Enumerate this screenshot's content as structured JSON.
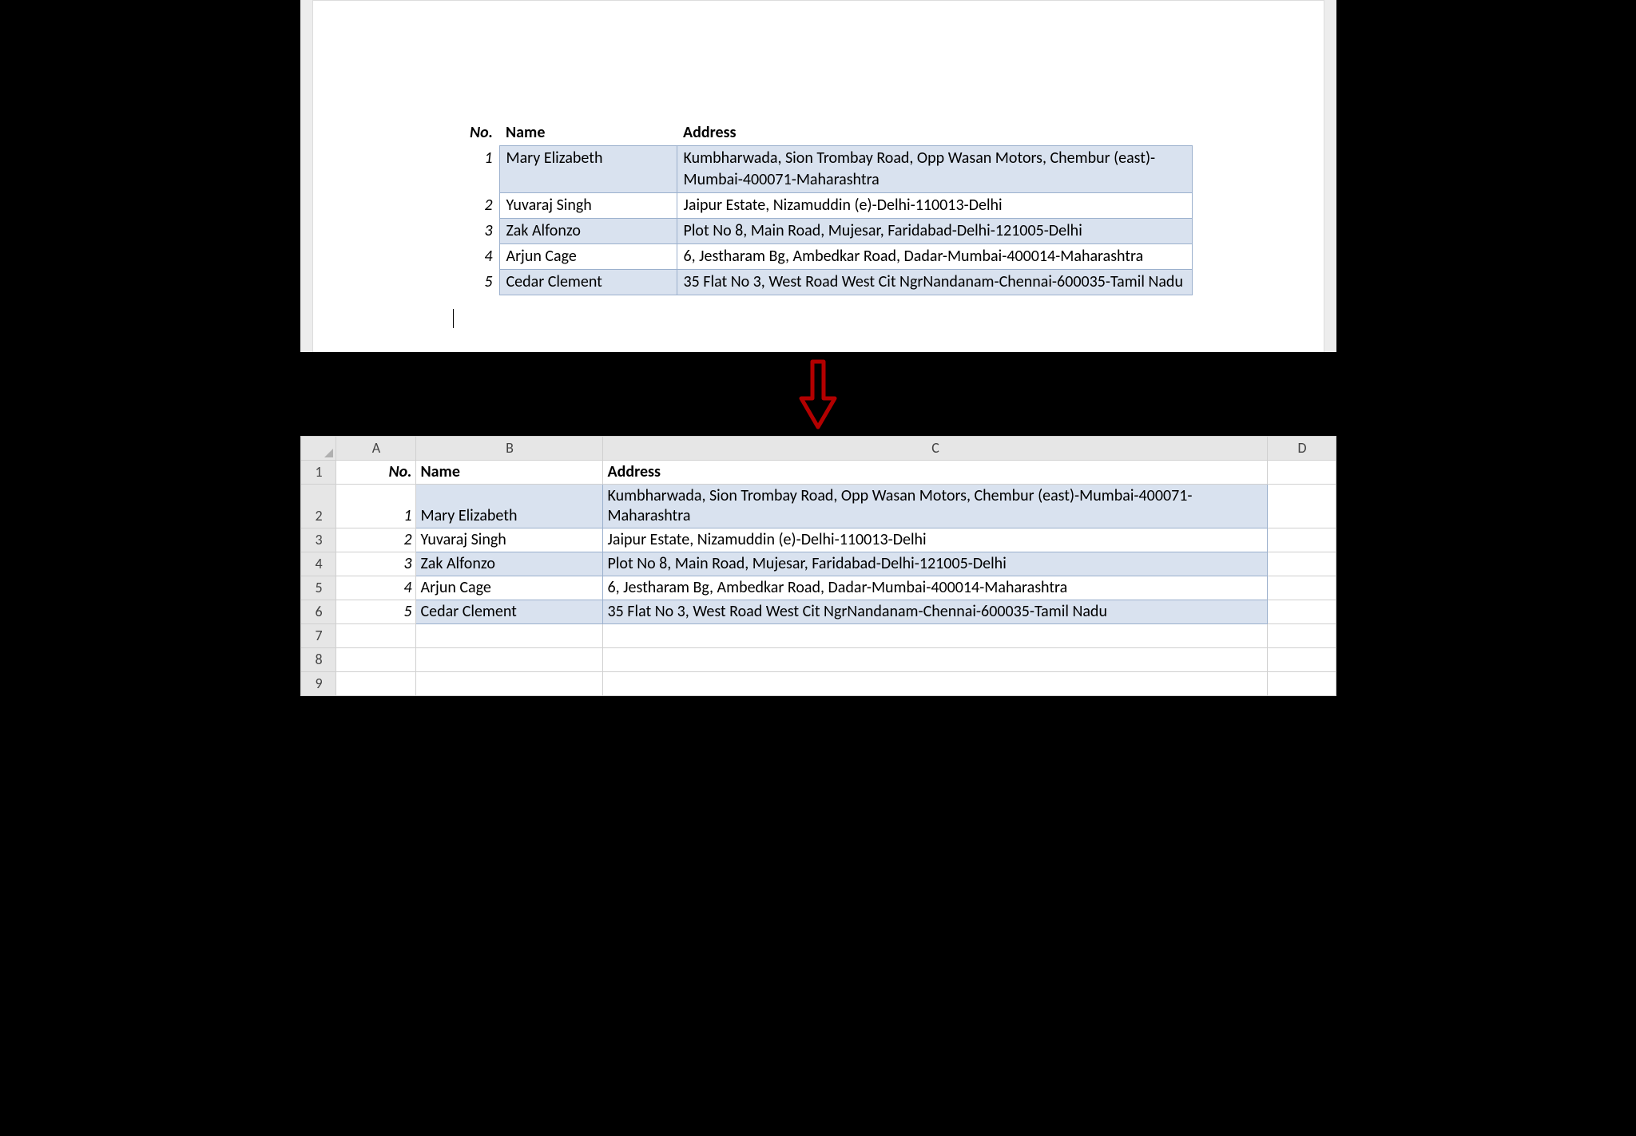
{
  "headers": {
    "no": "No.",
    "name": "Name",
    "addr": "Address"
  },
  "rows": [
    {
      "no": "1",
      "name": "Mary Elizabeth",
      "addr": "Kumbharwada, Sion Trombay Road, Opp Wasan Motors, Chembur (east)-Mumbai-400071-Maharashtra"
    },
    {
      "no": "2",
      "name": "Yuvaraj Singh",
      "addr": "Jaipur Estate, Nizamuddin (e)-Delhi-110013-Delhi"
    },
    {
      "no": "3",
      "name": "Zak Alfonzo",
      "addr": "Plot No 8, Main Road, Mujesar, Faridabad-Delhi-121005-Delhi"
    },
    {
      "no": "4",
      "name": "Arjun Cage",
      "addr": "6, Jestharam Bg, Ambedkar Road, Dadar-Mumbai-400014-Maharashtra"
    },
    {
      "no": "5",
      "name": "Cedar Clement",
      "addr": "35 Flat No 3, West Road West Cit NgrNandanam-Chennai-600035-Tamil Nadu"
    }
  ],
  "excel_cols": {
    "A": "A",
    "B": "B",
    "C": "C",
    "D": "D"
  },
  "excel_rownums": [
    "1",
    "2",
    "3",
    "4",
    "5",
    "6",
    "7",
    "8",
    "9"
  ]
}
